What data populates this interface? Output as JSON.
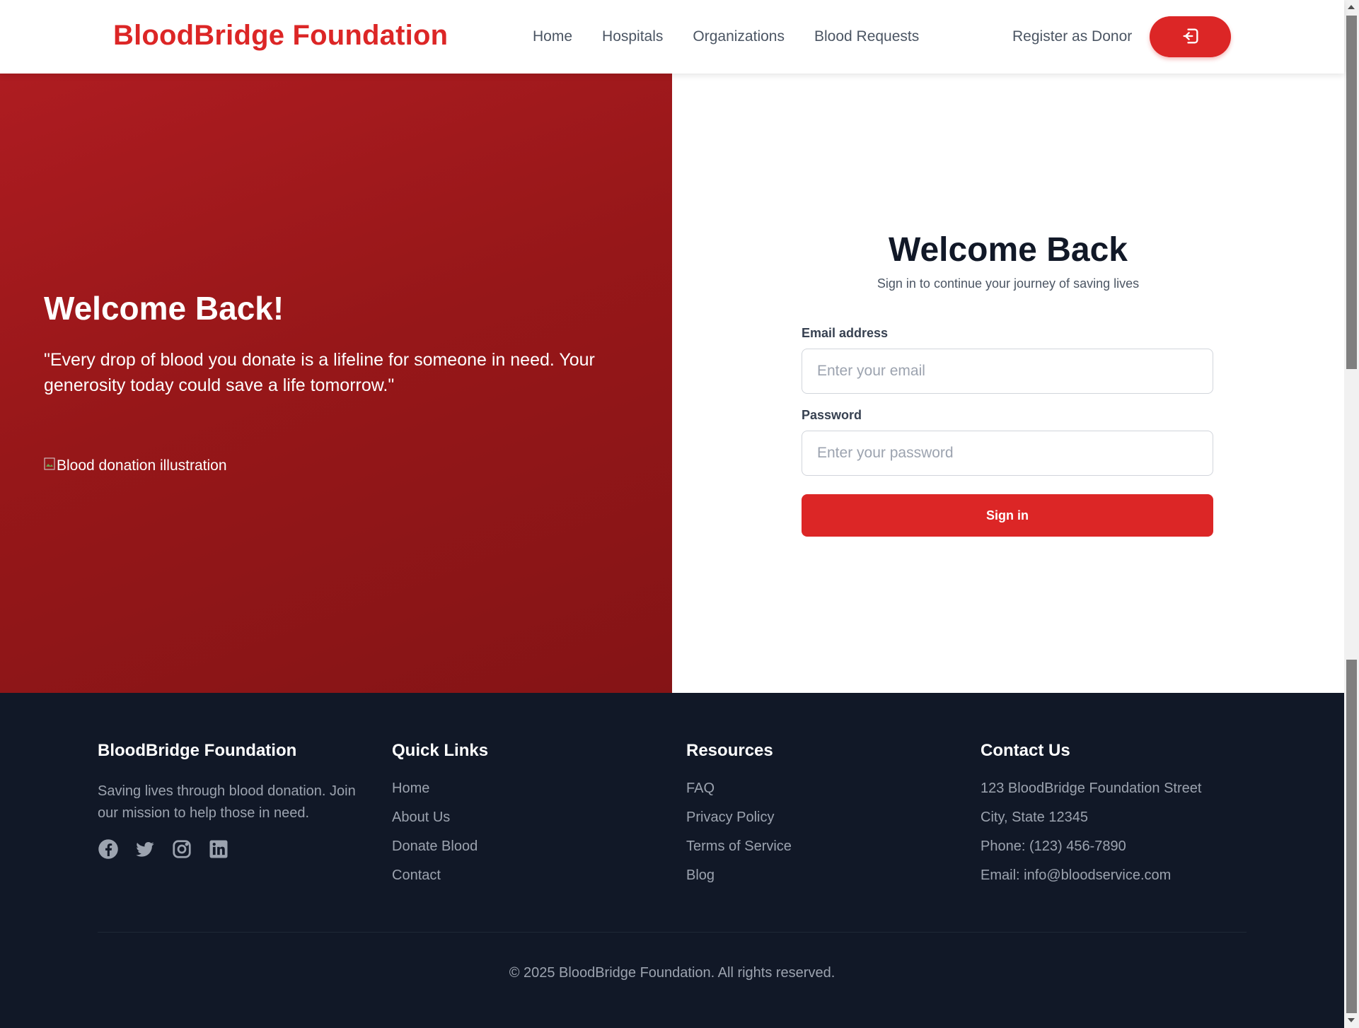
{
  "header": {
    "brand": "BloodBridge Foundation",
    "nav": [
      "Home",
      "Hospitals",
      "Organizations",
      "Blood Requests"
    ],
    "register": "Register as Donor",
    "login_icon": "login-icon"
  },
  "hero": {
    "title": "Welcome Back!",
    "quote": "\"Every drop of blood you donate is a lifeline for someone in need. Your generosity today could save a life tomorrow.\"",
    "image_alt": "Blood donation illustration"
  },
  "login": {
    "title": "Welcome Back",
    "subtitle": "Sign in to continue your journey of saving lives",
    "email_label": "Email address",
    "email_placeholder": "Enter your email",
    "password_label": "Password",
    "password_placeholder": "Enter your password",
    "submit": "Sign in"
  },
  "footer": {
    "about": {
      "title": "BloodBridge Foundation",
      "desc": "Saving lives through blood donation. Join our mission to help those in need.",
      "social": [
        "facebook-icon",
        "twitter-icon",
        "instagram-icon",
        "linkedin-icon"
      ]
    },
    "quick_links": {
      "title": "Quick Links",
      "items": [
        "Home",
        "About Us",
        "Donate Blood",
        "Contact"
      ]
    },
    "resources": {
      "title": "Resources",
      "items": [
        "FAQ",
        "Privacy Policy",
        "Terms of Service",
        "Blog"
      ]
    },
    "contact": {
      "title": "Contact Us",
      "items": [
        "123 BloodBridge Foundation Street",
        "City, State 12345",
        "Phone: (123) 456-7890",
        "Email: info@bloodservice.com"
      ]
    },
    "copyright": "© 2025 BloodBridge Foundation. All rights reserved."
  },
  "colors": {
    "accent": "#dc2626",
    "hero_bg": "#9b181b",
    "footer_bg": "#111827"
  }
}
